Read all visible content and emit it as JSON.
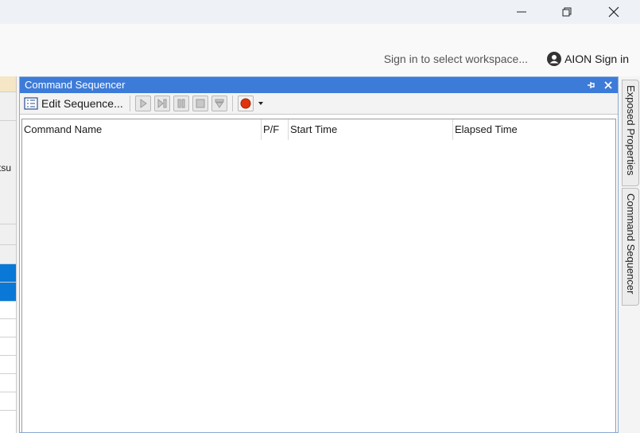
{
  "window": {
    "minimize_icon": "minimize-icon",
    "restore_icon": "restore-icon",
    "close_icon": "close-icon"
  },
  "header": {
    "workspace_hint": "Sign in to select workspace...",
    "aion_signin": "AION Sign in"
  },
  "left_strip": {
    "visible_text": "tsu"
  },
  "panel": {
    "title": "Command Sequencer",
    "toolbar": {
      "edit_label": "Edit Sequence..."
    },
    "columns": [
      "Command Name",
      "P/F",
      "Start Time",
      "Elapsed Time"
    ]
  },
  "right_tabs": [
    "Exposed Properties",
    "Command Sequencer"
  ],
  "colors": {
    "title_bar": "#3d7bd8",
    "selection": "#0a78d7",
    "record": "#e0340c"
  }
}
